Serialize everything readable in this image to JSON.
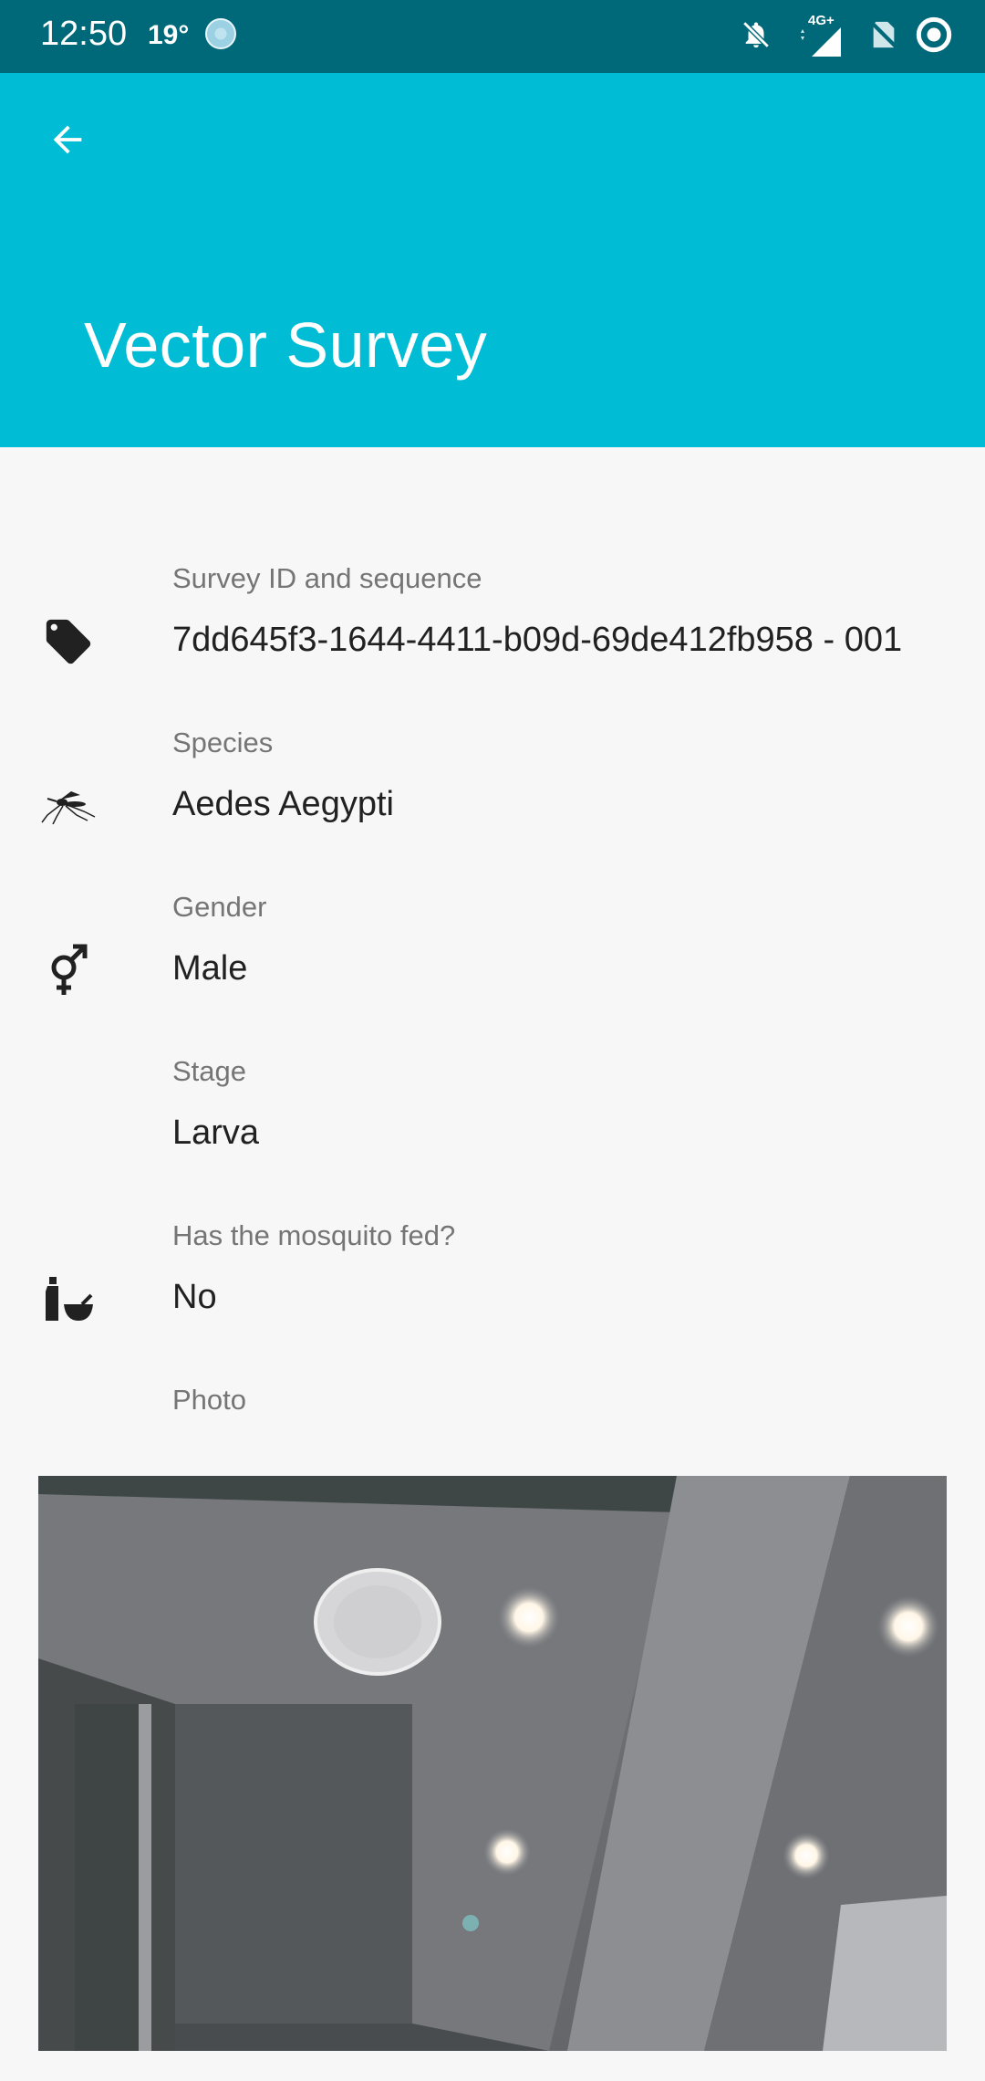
{
  "status_bar": {
    "time": "12:50",
    "temperature": "19°",
    "network": "4G+",
    "icons": [
      "weather-icon",
      "bell-off-icon",
      "signal-icon",
      "no-sim-icon",
      "record-icon"
    ]
  },
  "app_bar": {
    "title": "Vector Survey",
    "back_icon": "arrow-back-icon",
    "color": "#00bcd4"
  },
  "fields": {
    "survey_id": {
      "label": "Survey ID and sequence",
      "value": "7dd645f3-1644-4411-b09d-69de412fb958 - 001",
      "icon": "tag-icon"
    },
    "species": {
      "label": "Species",
      "value": "Aedes Aegypti",
      "icon": "mosquito-icon"
    },
    "gender": {
      "label": "Gender",
      "value": "Male",
      "icon": "gender-icon"
    },
    "stage": {
      "label": "Stage",
      "value": "Larva"
    },
    "fed": {
      "label": "Has the mosquito fed?",
      "value": "No",
      "icon": "bottle-bowl-icon"
    },
    "photo": {
      "label": "Photo"
    }
  }
}
